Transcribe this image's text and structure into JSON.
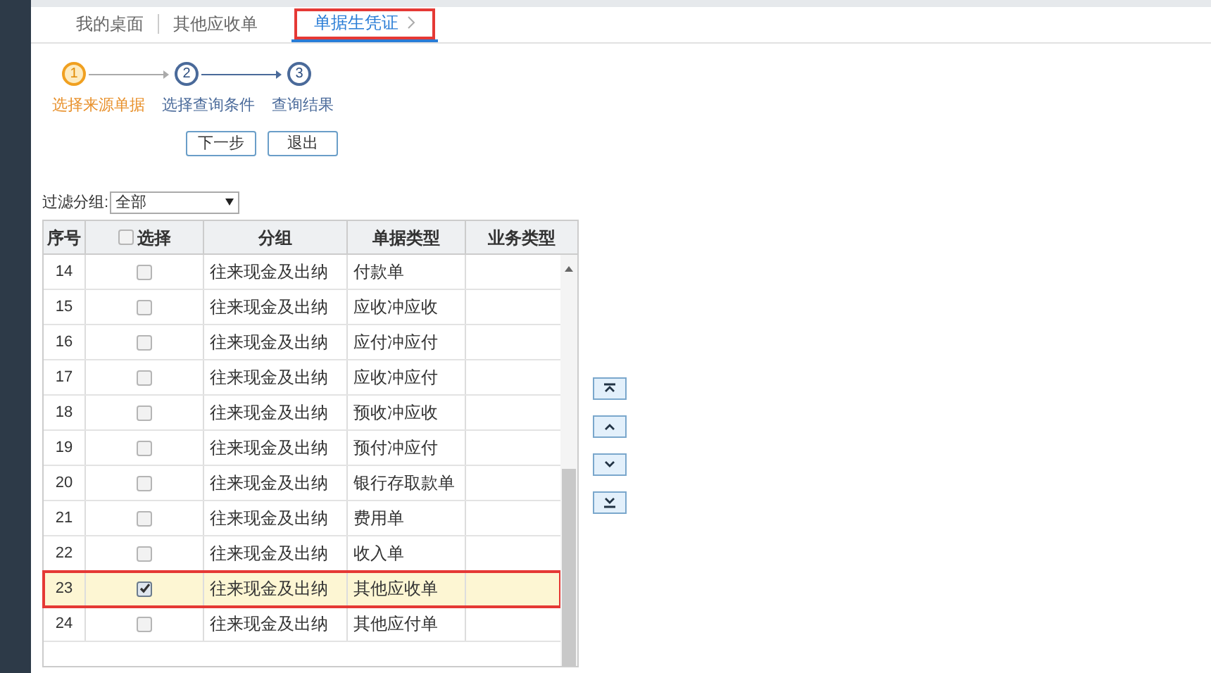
{
  "tabs": [
    {
      "label": "我的桌面",
      "selected": false,
      "closable": false
    },
    {
      "label": "其他应收单",
      "selected": false,
      "closable": false
    },
    {
      "label": "单据生凭证",
      "selected": true,
      "closable": true
    }
  ],
  "steps": [
    {
      "number": "1",
      "label": "选择来源单据",
      "selected": true
    },
    {
      "number": "2",
      "label": "选择查询条件",
      "selected": false
    },
    {
      "number": "3",
      "label": "查询结果",
      "selected": false
    }
  ],
  "buttons": [
    "下一步",
    "退出"
  ],
  "filter": {
    "label": "过滤分组:",
    "value": "全部"
  },
  "table": {
    "columns": [
      "序号",
      "选择",
      "分组",
      "单据类型",
      "业务类型"
    ],
    "select_all_checked": false,
    "rows": [
      {
        "no": "14",
        "checked": false,
        "group": "往来现金及出纳",
        "type": "付款单",
        "selected": false
      },
      {
        "no": "15",
        "checked": false,
        "group": "往来现金及出纳",
        "type": "应收冲应收",
        "selected": false
      },
      {
        "no": "16",
        "checked": false,
        "group": "往来现金及出纳",
        "type": "应付冲应付",
        "selected": false
      },
      {
        "no": "17",
        "checked": false,
        "group": "往来现金及出纳",
        "type": "应收冲应付",
        "selected": false
      },
      {
        "no": "18",
        "checked": false,
        "group": "往来现金及出纳",
        "type": "预收冲应收",
        "selected": false
      },
      {
        "no": "19",
        "checked": false,
        "group": "往来现金及出纳",
        "type": "预付冲应付",
        "selected": false
      },
      {
        "no": "20",
        "checked": false,
        "group": "往来现金及出纳",
        "type": "银行存取款单",
        "selected": false
      },
      {
        "no": "21",
        "checked": false,
        "group": "往来现金及出纳",
        "type": "费用单",
        "selected": false
      },
      {
        "no": "22",
        "checked": false,
        "group": "往来现金及出纳",
        "type": "收入单",
        "selected": false
      },
      {
        "no": "23",
        "checked": true,
        "group": "往来现金及出纳",
        "type": "其他应收单",
        "selected": true
      },
      {
        "no": "24",
        "checked": false,
        "group": "往来现金及出纳",
        "type": "其他应付单",
        "selected": false
      }
    ]
  }
}
